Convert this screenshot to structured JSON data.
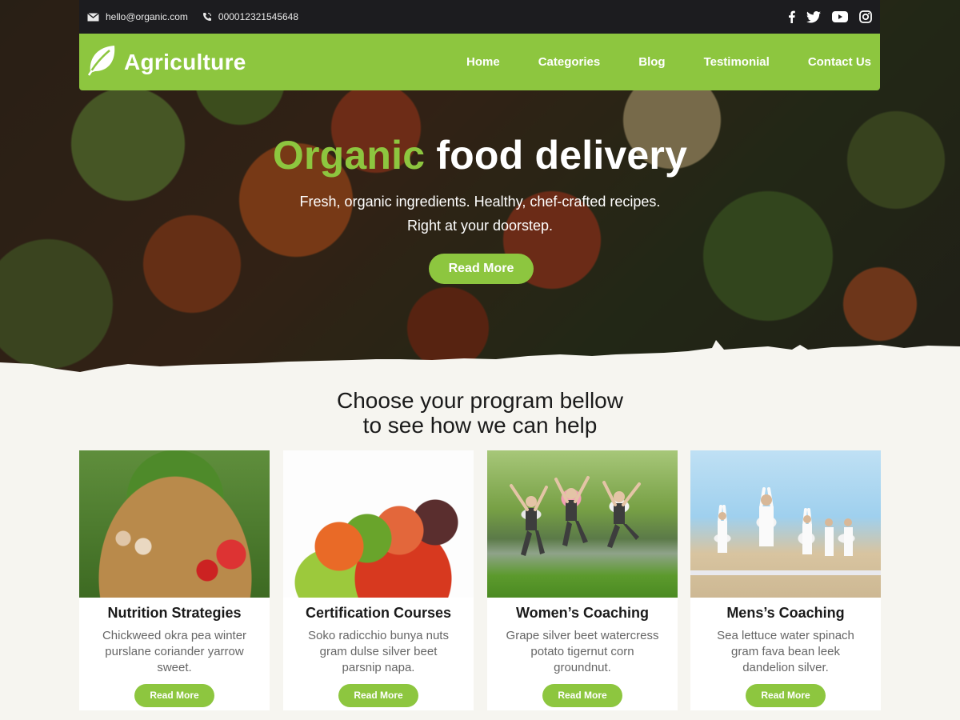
{
  "topbar": {
    "email": "hello@organic.com",
    "phone": "000012321545648",
    "social": [
      "facebook-icon",
      "twitter-icon",
      "youtube-icon",
      "instagram-icon"
    ]
  },
  "brand": {
    "name": "Agriculture",
    "accent_color": "#8dc63f",
    "dark_color": "#1c1c1f"
  },
  "nav": {
    "items": [
      "Home",
      "Categories",
      "Blog",
      "Testimonial",
      "Contact Us"
    ]
  },
  "hero": {
    "title_accent": "Organic",
    "title_rest": "food delivery",
    "subtitle_line1": "Fresh, organic ingredients. Healthy, chef-crafted recipes.",
    "subtitle_line2": "Right at your doorstep.",
    "button": "Read More"
  },
  "section": {
    "title_line1": "Choose your program bellow",
    "title_line2": "to see how we can help"
  },
  "cards": [
    {
      "title": "Nutrition Strategies",
      "desc": "Chickweed okra pea winter purslane coriander yarrow sweet.",
      "button": "Read More"
    },
    {
      "title": "Certification Courses",
      "desc": "Soko radicchio bunya nuts gram dulse silver beet parsnip napa.",
      "button": "Read More"
    },
    {
      "title": "Women’s Coaching",
      "desc": "Grape silver beet watercress potato tigernut corn groundnut.",
      "button": "Read More"
    },
    {
      "title": "Mens’s Coaching",
      "desc": "Sea lettuce water spinach gram fava bean leek dandelion silver.",
      "button": "Read More"
    }
  ]
}
